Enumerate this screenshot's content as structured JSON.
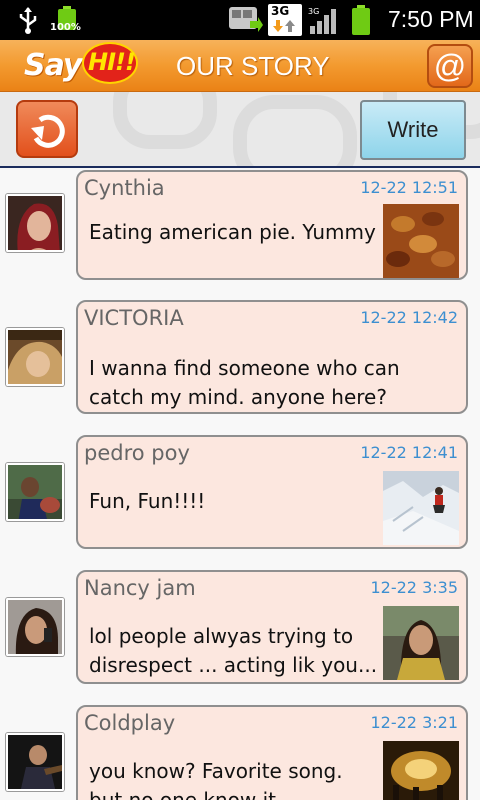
{
  "status_bar": {
    "battery_percent": "100%",
    "network_type": "3G",
    "time": "7:50 PM"
  },
  "header": {
    "logo_say": "Say",
    "logo_hi": "HI!!",
    "title": "OUR STORY",
    "at_label": "@"
  },
  "toolbar": {
    "write_label": "Write"
  },
  "posts": [
    {
      "name": "Cynthia",
      "time": "12-22 12:51",
      "message": [
        "Eating american pie. Yummy",
        ""
      ],
      "has_photo": true
    },
    {
      "name": "VICTORIA",
      "time": "12-22 12:42",
      "message": [
        "I wanna find someone who can",
        "catch my mind. anyone here?"
      ],
      "has_photo": false
    },
    {
      "name": "pedro poy",
      "time": "12-22 12:41",
      "message": [
        "Fun, Fun!!!!",
        ""
      ],
      "has_photo": true
    },
    {
      "name": "Nancy jam",
      "time": "12-22 3:35",
      "message": [
        "lol people alwyas trying to",
        "disrespect ... acting lik you..."
      ],
      "has_photo": true
    },
    {
      "name": "Coldplay",
      "time": "12-22 3:21",
      "message": [
        "you know? Favorite song.",
        "but no one know it"
      ],
      "has_photo": true
    }
  ]
}
